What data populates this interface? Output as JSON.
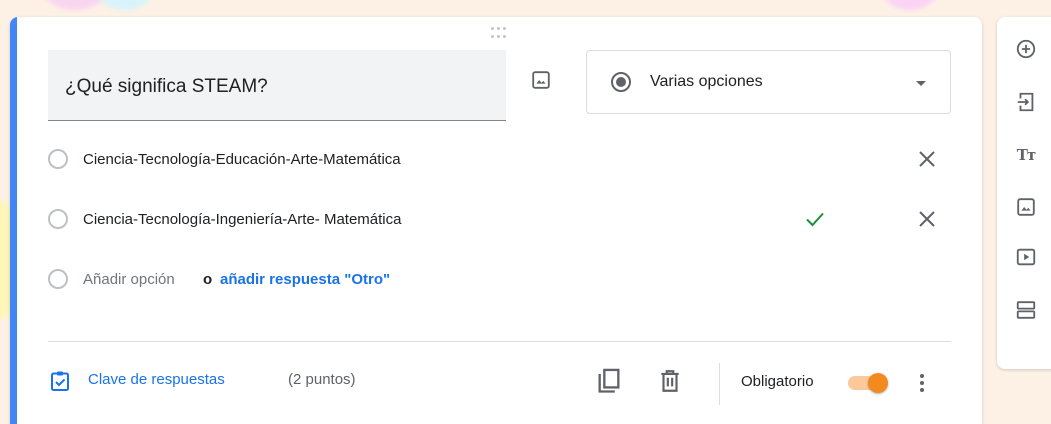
{
  "question": {
    "title": "¿Qué significa STEAM?",
    "type_label": "Varias opciones"
  },
  "options": [
    {
      "label": "Ciencia-Tecnología-Educación-Arte-Matemática",
      "correct": false
    },
    {
      "label": "Ciencia-Tecnología-Ingeniería-Arte- Matemática",
      "correct": true
    }
  ],
  "add_option": {
    "label": "Añadir opción",
    "or": "o",
    "other_link": "añadir respuesta \"Otro\""
  },
  "footer": {
    "answer_key_label": "Clave de respuestas",
    "points_label": "(2 puntos)",
    "required_label": "Obligatorio",
    "required": true
  },
  "sidebar_tools": [
    {
      "icon": "add-circle-icon"
    },
    {
      "icon": "import-questions-icon"
    },
    {
      "icon": "title-text-icon",
      "text": "Tт"
    },
    {
      "icon": "image-icon"
    },
    {
      "icon": "video-icon"
    },
    {
      "icon": "section-icon"
    }
  ],
  "colors": {
    "accent": "#4285f4",
    "link": "#1a73e8",
    "correct": "#1e8e3e",
    "toggle": "#f28a20"
  }
}
